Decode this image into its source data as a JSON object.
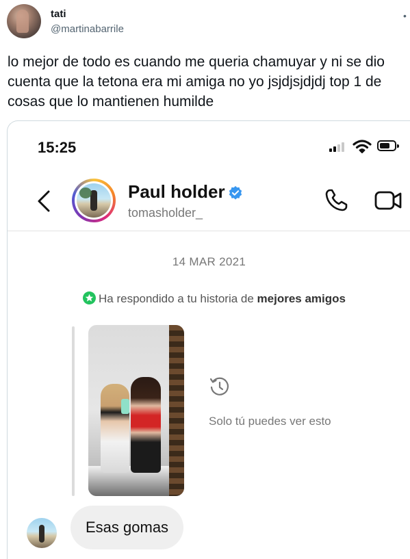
{
  "tweet": {
    "author_name": "tati",
    "author_handle": "@martinabarrile",
    "text": "lo mejor de todo es cuando me queria chamuyar y ni se dio cuenta que la tetona era mi amiga no yo jsjdjsjdjdj top 1 de cosas que lo mantienen humilde"
  },
  "screenshot": {
    "status_bar": {
      "time": "15:25"
    },
    "chat_header": {
      "contact_name": "Paul holder",
      "contact_handle": "tomasholder_"
    },
    "conversation": {
      "date": "14 MAR 2021",
      "story_reply_prefix": "Ha respondido a tu historia de",
      "story_reply_emphasis": "mejores amigos",
      "private_note": "Solo tú puedes ver esto",
      "message": "Esas gomas"
    }
  },
  "colors": {
    "verified": "#3897f0",
    "close_friends": "#22c35e",
    "bubble": "#efefef"
  },
  "icons": [
    "more-icon",
    "signal-icon",
    "wifi-icon",
    "battery-icon",
    "back-icon",
    "verified-icon",
    "phone-icon",
    "video-icon",
    "star-icon",
    "history-icon"
  ]
}
